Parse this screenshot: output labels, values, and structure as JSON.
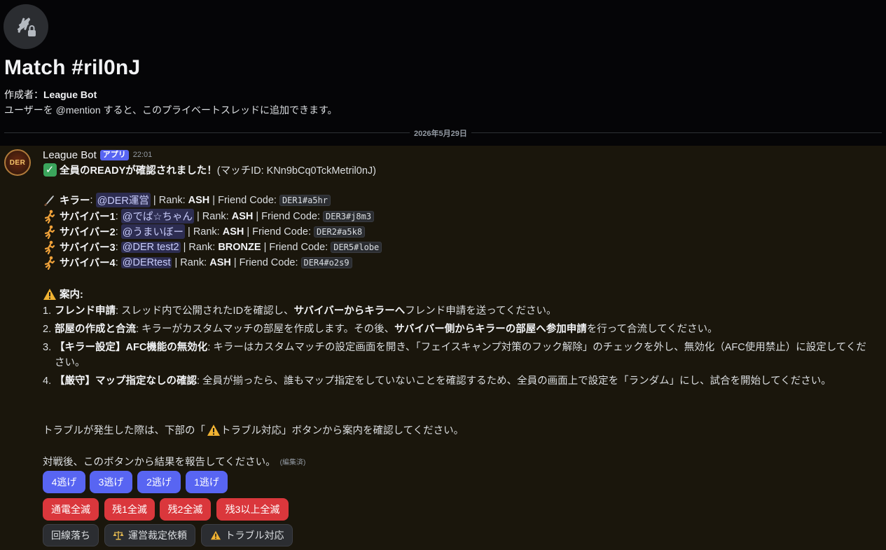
{
  "thread": {
    "icon": "thread-lock-icon",
    "title": "Match #ril0nJ",
    "creator_label": "作成者：",
    "creator_name": "League Bot",
    "description": "ユーザーを @mention すると、このプライベートスレッドに追加できます。",
    "date_divider": "2026年5月29日"
  },
  "message": {
    "author": "League Bot",
    "badge": "アプリ",
    "time": "22:01",
    "avatar_text": "DER",
    "ready_line": {
      "icon": "check-mark-icon",
      "bold": "全員のREADYが確認されました！",
      "rest": " (マッチID: KNn9bCq0TckMetril0nJ)"
    },
    "players": [
      {
        "icon": "knife-icon",
        "role": "キラー",
        "mention": "@DER運営",
        "rank": "ASH",
        "code": "DER1#a5hr"
      },
      {
        "icon": "runner-icon",
        "role": "サバイバー1",
        "mention": "@でぱ☆ちゃん",
        "rank": "ASH",
        "code": "DER3#j8m3"
      },
      {
        "icon": "runner-icon",
        "role": "サバイバー2",
        "mention": "@うまいぼー",
        "rank": "ASH",
        "code": "DER2#a5k8"
      },
      {
        "icon": "runner-icon",
        "role": "サバイバー3",
        "mention": "@DER test2",
        "rank": "BRONZE",
        "code": "DER5#lobe"
      },
      {
        "icon": "runner-icon",
        "role": "サバイバー4",
        "mention": "@DERtest",
        "rank": "ASH",
        "code": "DER4#o2s9"
      }
    ],
    "player_labels": {
      "rank_prefix": " | Rank: ",
      "code_prefix": " | Friend Code: ",
      "colon": ": "
    },
    "guide_title": "案内:",
    "guide": [
      {
        "num": "1.",
        "bold": "フレンド申請",
        "text1": ": スレッド内で公開されたIDを確認し、",
        "bold2": "サバイバーからキラーへ",
        "text2": "フレンド申請を送ってください。"
      },
      {
        "num": "2.",
        "bold": "部屋の作成と合流",
        "text1": ": キラーがカスタムマッチの部屋を作成します。その後、",
        "bold2": "サバイバー側からキラーの部屋へ参加申請",
        "text2": "を行って合流してください。"
      },
      {
        "num": "3.",
        "bold": "【キラー設定】AFC機能の無効化",
        "text1": ": キラーはカスタムマッチの設定画面を開き、「フェイスキャンプ対策のフック解除」のチェックを外し、無効化（AFC使用禁止）に設定してください。",
        "bold2": "",
        "text2": ""
      },
      {
        "num": "4.",
        "bold": "【厳守】マップ指定なしの確認",
        "text1": ": 全員が揃ったら、誰もマップ指定をしていないことを確認するため、全員の画面上で設定を「ランダム」にし、試合を開始してください。",
        "bold2": "",
        "text2": ""
      }
    ],
    "trouble_pre": "トラブルが発生した際は、下部の「",
    "trouble_post": " トラブル対応」ボタンから案内を確認してください。",
    "report_text": "対戦後、このボタンから結果を報告してください。",
    "edited": "(編集済)"
  },
  "buttons": {
    "row1": [
      "4逃げ",
      "3逃げ",
      "2逃げ",
      "1逃げ"
    ],
    "row2": [
      "通電全滅",
      "残1全滅",
      "残2全滅",
      "残3以上全滅"
    ],
    "row3": [
      {
        "label": "回線落ち",
        "icon": ""
      },
      {
        "label": "運営裁定依頼",
        "icon": "scales-icon"
      },
      {
        "label": "トラブル対応",
        "icon": "warning-icon"
      }
    ]
  },
  "colors": {
    "primary": "#5865f2",
    "danger": "#da373c",
    "secondary": "#2b2d31",
    "message_bg": "#1a160c"
  }
}
